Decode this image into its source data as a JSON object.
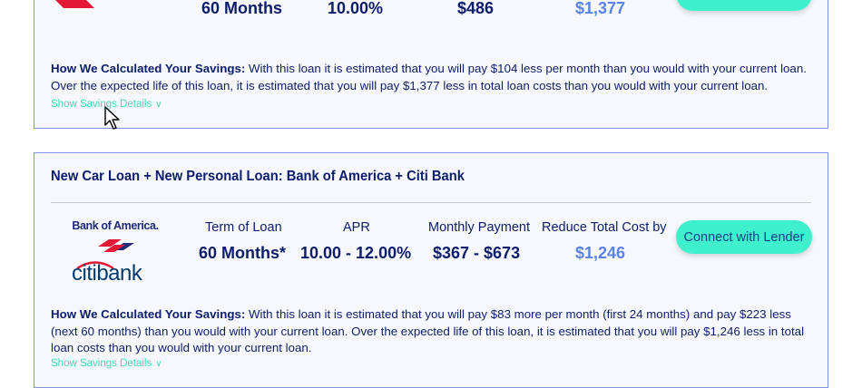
{
  "card1": {
    "term_value": "60 Months",
    "apr_value": "10.00%",
    "payment_value": "$486",
    "savings_value": "$1,377",
    "explain_label": "How We Calculated Your Savings:",
    "explain_text": "With this loan it is estimated that you will pay $104 less per month than you would with your current loan. Over the expected life of this loan, it is estimated that you will pay $1,377 less in total loan costs than you would with your current loan.",
    "details_link": "Show Savings Details"
  },
  "card2": {
    "title": "New Car Loan + New Personal Loan: Bank of America + Citi Bank",
    "bofa_logo_text": "Bank of America.",
    "citi_logo_text": "citibank",
    "term_label": "Term of Loan",
    "apr_label": "APR",
    "payment_label": "Monthly Payment",
    "savings_label": "Reduce Total Cost by",
    "term_value": "60 Months*",
    "apr_value": "10.00 - 12.00%",
    "payment_value": "$367 - $673",
    "savings_value": "$1,246",
    "connect_label": "Connect with Lender",
    "explain_label": "How We Calculated Your Savings:",
    "explain_text": "With this loan it is estimated that you will pay $83 more per month (first 24 months) and pay $223 less (next 60 months) than you would with your current loan. Over the expected life of this loan, it is estimated that you will pay $1,246 less in total loan costs than you would with your current loan.",
    "details_link": "Show Savings Details"
  },
  "colors": {
    "accent_teal": "#3ff0cd",
    "link_teal": "#3ed9b8",
    "navy_text": "#0c1d6b",
    "savings_blue": "#5b82e8",
    "card_border": "#7c93e6",
    "bofa_red": "#e31837",
    "citi_blue": "#003b70"
  }
}
